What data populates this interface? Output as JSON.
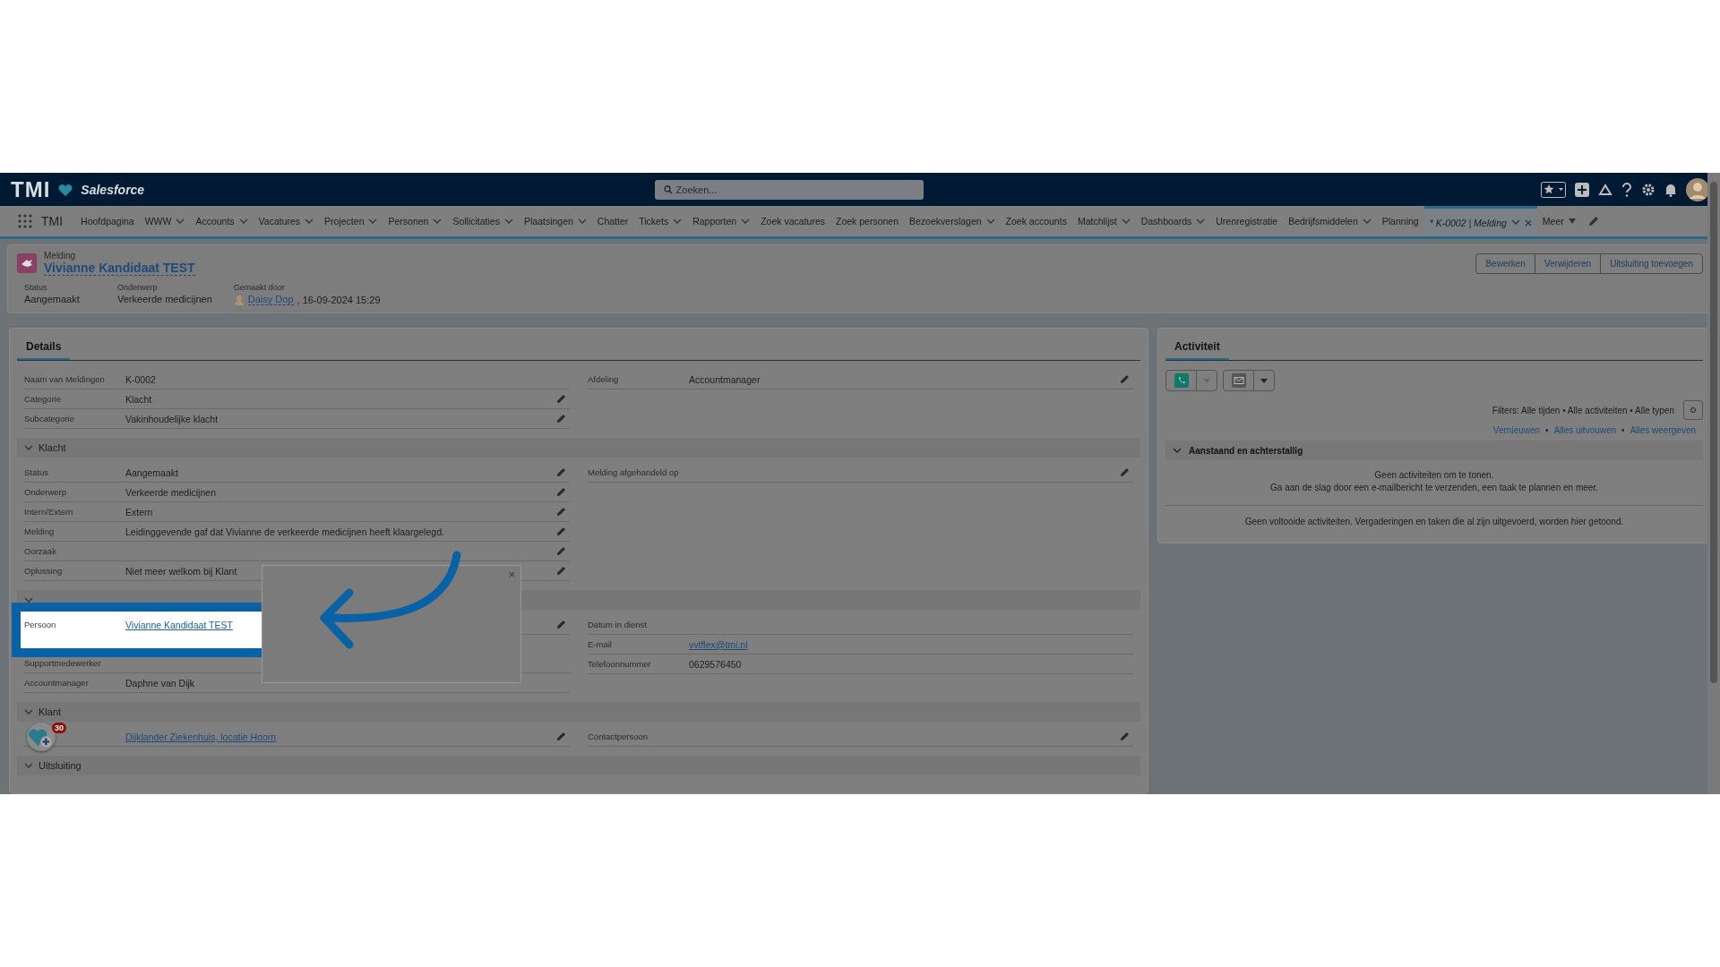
{
  "top_bar": {
    "brand": "TMI",
    "product": "Salesforce",
    "search": {
      "placeholder": "Zoeken..."
    }
  },
  "nav": {
    "app_name": "TMI",
    "items": [
      {
        "label": "Hoofdpagina",
        "dropdown": false,
        "selected": false,
        "kind": "page"
      },
      {
        "label": "WWW",
        "dropdown": true,
        "selected": false,
        "kind": "page"
      },
      {
        "label": "Accounts",
        "dropdown": true,
        "selected": false,
        "kind": "page"
      },
      {
        "label": "Vacatures",
        "dropdown": true,
        "selected": false,
        "kind": "page"
      },
      {
        "label": "Projecten",
        "dropdown": true,
        "selected": false,
        "kind": "page"
      },
      {
        "label": "Personen",
        "dropdown": true,
        "selected": false,
        "kind": "page"
      },
      {
        "label": "Sollicitaties",
        "dropdown": true,
        "selected": false,
        "kind": "page"
      },
      {
        "label": "Plaatsingen",
        "dropdown": true,
        "selected": false,
        "kind": "page"
      },
      {
        "label": "Chatter",
        "dropdown": false,
        "selected": false,
        "kind": "page"
      },
      {
        "label": "Tickets",
        "dropdown": true,
        "selected": false,
        "kind": "page"
      },
      {
        "label": "Rapporten",
        "dropdown": true,
        "selected": false,
        "kind": "page"
      },
      {
        "label": "Zoek vacatures",
        "dropdown": false,
        "selected": false,
        "kind": "page"
      },
      {
        "label": "Zoek personen",
        "dropdown": false,
        "selected": false,
        "kind": "page"
      },
      {
        "label": "Bezoekverslagen",
        "dropdown": true,
        "selected": false,
        "kind": "page"
      },
      {
        "label": "Zoek accounts",
        "dropdown": false,
        "selected": false,
        "kind": "page"
      },
      {
        "label": "Matchlijst",
        "dropdown": true,
        "selected": false,
        "kind": "page"
      },
      {
        "label": "Dashboards",
        "dropdown": true,
        "selected": false,
        "kind": "page"
      },
      {
        "label": "Urenregistratie",
        "dropdown": false,
        "selected": false,
        "kind": "page"
      },
      {
        "label": "Bedrijfsmiddelen",
        "dropdown": true,
        "selected": false,
        "kind": "page"
      },
      {
        "label": "Planning",
        "dropdown": false,
        "selected": false,
        "kind": "page"
      },
      {
        "label": "* K-0002 | Melding",
        "dropdown": true,
        "selected": true,
        "kind": "record"
      }
    ],
    "more": "Meer"
  },
  "record": {
    "object": "Melding",
    "title": "Vivianne Kandidaat TEST",
    "fields": [
      {
        "label": "Status",
        "value": "Aangemaakt",
        "kind": "text"
      },
      {
        "label": "Onderwerp",
        "value": "Verkeerde medicijnen",
        "kind": "text"
      },
      {
        "label": "Gemaakt door",
        "value": "Daisy Dop",
        "suffix": ", 16-09-2024 15:29",
        "kind": "user"
      }
    ],
    "buttons": [
      "Bewerken",
      "Verwijderen",
      "Uitsluiting toevoegen"
    ]
  },
  "details": {
    "tab": "Details",
    "sections": [
      {
        "left": [
          {
            "label": "Naam van Meldingen",
            "value": "K-0002",
            "kind": "text",
            "editable": false
          },
          {
            "label": "Categorie",
            "value": "Klacht",
            "kind": "text",
            "editable": true
          },
          {
            "label": "Subcategorie",
            "value": "Vakinhoudelijke klacht",
            "kind": "text",
            "editable": true
          }
        ],
        "right": [
          {
            "label": "Afdeling",
            "value": "Accountmanager",
            "kind": "text",
            "editable": true
          }
        ]
      },
      {
        "title": "Klacht",
        "expanded": true,
        "left": [
          {
            "label": "Status",
            "value": "Aangemaakt",
            "kind": "text",
            "editable": true
          },
          {
            "label": "Onderwerp",
            "value": "Verkeerde medicijnen",
            "kind": "text",
            "editable": true
          },
          {
            "label": "Intern/Extern",
            "value": "Extern",
            "kind": "text",
            "editable": true
          },
          {
            "label": "Melding",
            "value": "Leidinggevende gaf dat Vivianne de verkeerde medicijnen heeft klaargelegd.",
            "kind": "text",
            "editable": true
          },
          {
            "label": "Oorzaak",
            "editable": true
          },
          {
            "label": "Oplossing",
            "value": "Niet meer welkom bij Klant",
            "kind": "text",
            "editable": true
          }
        ],
        "right": [
          {
            "label": "Melding afgehandeld op",
            "editable": true
          }
        ]
      },
      {
        "expanded": true,
        "left": [
          {
            "label": "Persoon",
            "value": "Vivianne Kandidaat TEST",
            "kind": "link",
            "editable": true,
            "highlighted": true
          },
          {
            "label": "Supportmedewerker",
            "editable": false
          },
          {
            "label": "Accountmanager",
            "value": "Daphne van Dijk",
            "kind": "text",
            "editable": false
          }
        ],
        "right": [
          {
            "label": "Datum in dienst",
            "editable": false
          },
          {
            "label": "E-mail",
            "value": "vvtflex@tmi.nl",
            "kind": "link",
            "editable": false
          },
          {
            "label": "Telefoonnummer",
            "value": "0629576450",
            "kind": "text",
            "editable": false
          }
        ]
      },
      {
        "title": "Klant",
        "expanded": true,
        "left": [
          {
            "value": "Dijklander Ziekenhuis, locatie Hoorn",
            "kind": "link",
            "editable": true
          }
        ],
        "right": [
          {
            "label": "Contactpersoon",
            "editable": true
          }
        ]
      },
      {
        "title": "Uitsluiting",
        "expanded": true
      }
    ]
  },
  "activity": {
    "tab": "Activiteit",
    "filters": "Filters: Alle tijden • Alle activiteiten • Alle typen",
    "links": [
      "Vernieuwen",
      "Alles uitvouwen",
      "Alles weergeven"
    ],
    "separator": "•",
    "section": {
      "title": "Aanstaand en achterstallig",
      "expanded": true,
      "empty": [
        "Geen activiteiten om te tonen.",
        "Ga aan de slag door een e-mailbericht te verzenden, een taak te plannen en meer."
      ]
    },
    "completed": "Geen voltooide activiteiten. Vergaderingen en taken die al zijn uitgevoerd, worden hier getoond."
  },
  "tooltip": {
    "close": "×"
  },
  "widget": {
    "badge": "30"
  }
}
